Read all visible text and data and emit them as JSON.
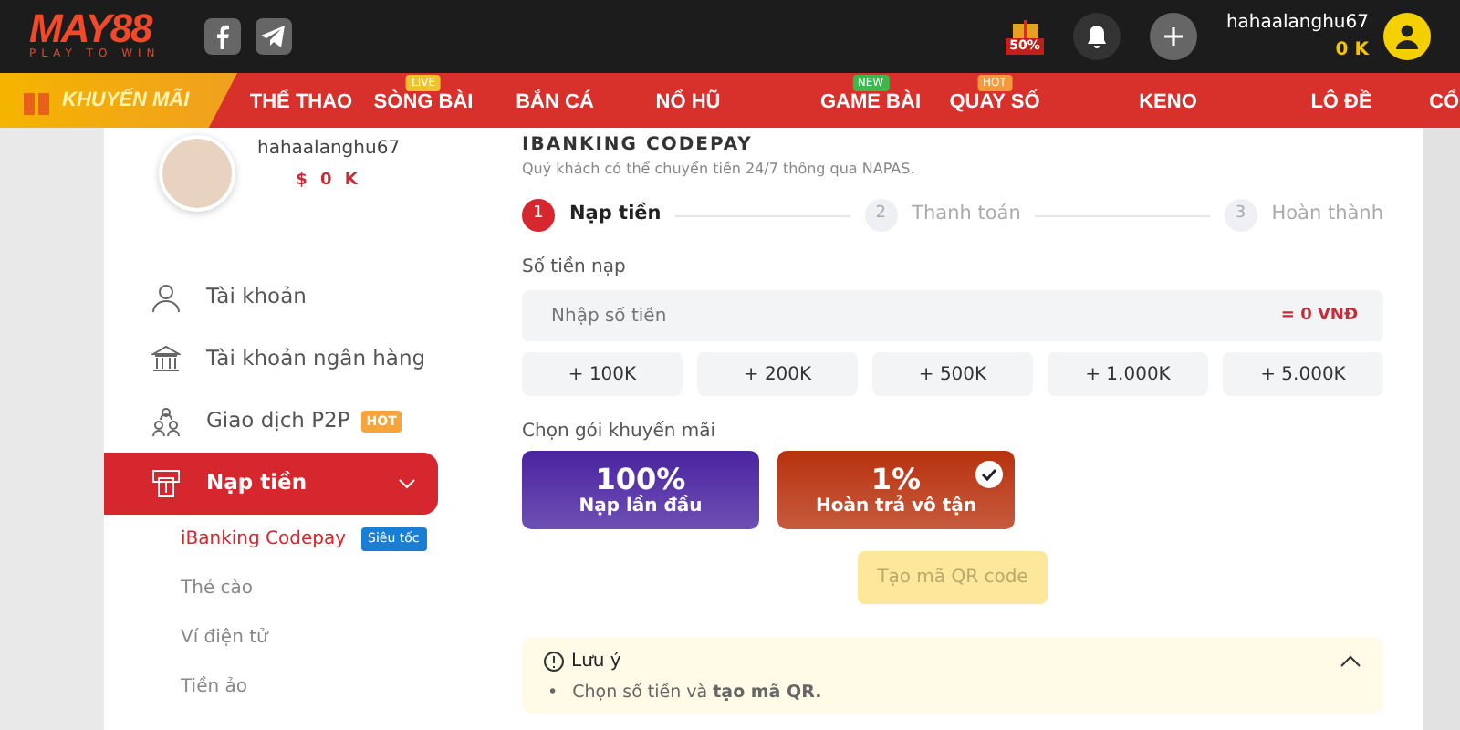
{
  "header": {
    "logo": "MAY88",
    "tagline": "PLAY TO WIN",
    "promo_badge": "50%",
    "username": "hahaalanghu67",
    "balance": "0 K"
  },
  "nav": [
    {
      "label": "KHUYẾN MÃI",
      "kind": "promo"
    },
    {
      "label": "THỂ THAO",
      "kind": "link"
    },
    {
      "label": "SÒNG BÀI",
      "kind": "link",
      "badge": {
        "text": "LIVE",
        "color": "#f2c12e"
      }
    },
    {
      "label": "BẮN CÁ",
      "kind": "link"
    },
    {
      "label": "NỔ HŨ",
      "kind": "link"
    },
    {
      "label": "GAME BÀI",
      "kind": "link",
      "badge": {
        "text": "NEW",
        "color": "#3cb94a"
      }
    },
    {
      "label": "QUAY SỐ",
      "kind": "link",
      "badge": {
        "text": "HOT",
        "color": "#f59a3c"
      }
    },
    {
      "label": "KENO",
      "kind": "link"
    },
    {
      "label": "LÔ ĐỀ",
      "kind": "link"
    },
    {
      "label": "CỔ",
      "kind": "link"
    }
  ],
  "profile": {
    "username": "hahaalanghu67",
    "balance": "$ 0 K"
  },
  "sidebar": {
    "items": [
      {
        "label": "Tài khoản",
        "selected": false
      },
      {
        "label": "Tài khoản ngân hàng",
        "selected": false
      },
      {
        "label": "Giao dịch P2P",
        "selected": false,
        "badge": "HOT"
      },
      {
        "label": "Nạp tiền",
        "selected": true,
        "expanded": true,
        "children": [
          {
            "label": "iBanking Codepay",
            "selected": true,
            "badge": "Siêu tốc"
          },
          {
            "label": "Thẻ cào",
            "selected": false
          },
          {
            "label": "Ví điện tử",
            "selected": false
          },
          {
            "label": "Tiền ảo",
            "selected": false
          }
        ]
      }
    ]
  },
  "main": {
    "title": "IBANKING CODEPAY",
    "subtitle": "Quý khách có thể chuyển tiền 24/7 thông qua NAPAS.",
    "steps": [
      {
        "number": "1",
        "label": "Nạp tiền",
        "selected": true
      },
      {
        "number": "2",
        "label": "Thanh toán",
        "selected": false
      },
      {
        "number": "3",
        "label": "Hoàn thành",
        "selected": false
      }
    ],
    "amount_label": "Số tiền nạp",
    "amount_field": {
      "placeholder": "Nhập số tiền",
      "converted": "= 0 VNĐ"
    },
    "quick_amounts": [
      "+ 100K",
      "+ 200K",
      "+ 500K",
      "+ 1.000K",
      "+ 5.000K"
    ],
    "promo_label": "Chọn gói khuyến mãi",
    "promos": [
      {
        "value": "100%",
        "label": "Nạp lần đầu",
        "color": "#4a24a0",
        "selected": false
      },
      {
        "value": "1%",
        "label": "Hoàn trả vô tận",
        "color": "#b8320e",
        "selected": true
      }
    ],
    "submit": {
      "label": "Tạo mã QR code",
      "disabled": true
    },
    "note": {
      "title": "Lưu ý",
      "expanded": true,
      "items": [
        {
          "bullet": "•",
          "text": "Chọn số tiền và **tạo mã QR.**"
        }
      ]
    }
  }
}
